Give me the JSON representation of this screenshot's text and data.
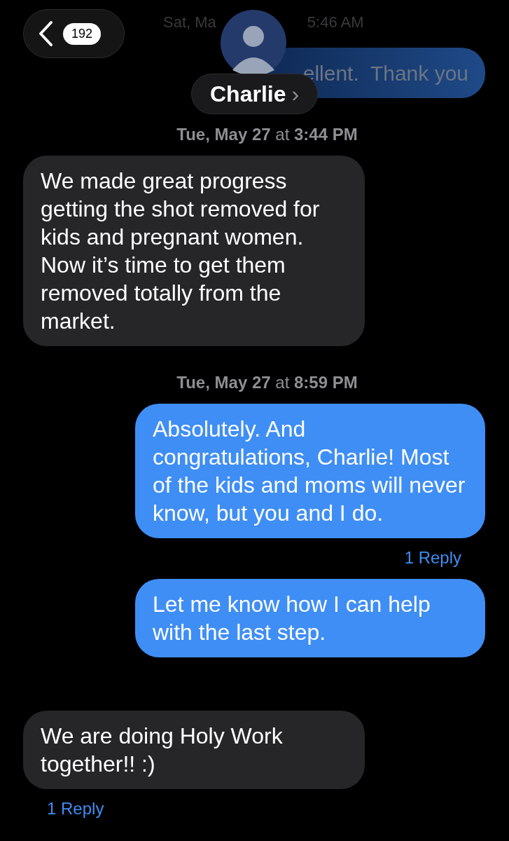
{
  "header": {
    "back_count": "192",
    "contact_name": "Charlie",
    "contact_chevron": "›"
  },
  "faded_timestamp": [
    "Sat, Ma",
    "5:46 AM"
  ],
  "faded_message": {
    "from_me": true,
    "text": "ellent.  Thank you"
  },
  "items": [
    {
      "kind": "timestamp",
      "text": "**Tue, May 27** at **3:44 PM**"
    },
    {
      "kind": "message",
      "from_me": false,
      "text": "We made great progress getting the shot removed for kids and pregnant women. Now it’s time to get them removed totally from the market."
    },
    {
      "kind": "timestamp",
      "text": "**Tue, May 27** at **8:59 PM**"
    },
    {
      "kind": "message",
      "from_me": true,
      "text": "Absolutely. And congratulations, Charlie! Most of the kids and moms will never know, but you and I do.",
      "reply_link": "1 Reply"
    },
    {
      "kind": "message",
      "from_me": true,
      "text": "Let me know how I can help with the last step."
    },
    {
      "kind": "message",
      "from_me": false,
      "text": "We are doing Holy Work together!! :)",
      "reply_link": "1 Reply"
    }
  ]
}
